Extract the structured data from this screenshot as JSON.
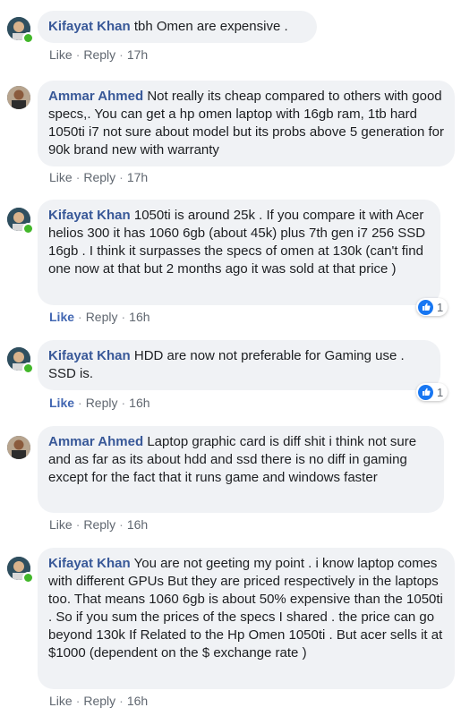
{
  "comments": [
    {
      "author": "Kifayat Khan",
      "text": "tbh Omen are expensive .",
      "like": "Like",
      "reply": "Reply",
      "time": "17h"
    },
    {
      "author": "Ammar Ahmed",
      "text": "Not really its cheap compared to others with good specs,. You can get a hp omen laptop with 16gb ram, 1tb hard 1050ti i7 not sure about model but its probs above 5 generation for 90k brand new with warranty",
      "like": "Like",
      "reply": "Reply",
      "time": "17h"
    },
    {
      "author": "Kifayat Khan",
      "text": "1050ti is around 25k . If you compare it with Acer helios 300 it has 1060 6gb (about 45k) plus 7th gen i7 256 SSD 16gb . I think it surpasses the specs of omen at 130k (can't find one now at that but 2 months ago it was sold at that price )",
      "like": "Like",
      "reply": "Reply",
      "time": "16h",
      "reactions": "1"
    },
    {
      "author": "Kifayat Khan",
      "text": "HDD are now not preferable for Gaming use . SSD is.",
      "like": "Like",
      "reply": "Reply",
      "time": "16h",
      "reactions": "1"
    },
    {
      "author": "Ammar Ahmed",
      "text": "Laptop graphic card is diff shit i think not sure and as far as its about hdd and ssd there is no diff in gaming except for the fact that it runs game and windows faster",
      "like": "Like",
      "reply": "Reply",
      "time": "16h"
    },
    {
      "author": "Kifayat Khan",
      "text": "You are not geeting my point . i know laptop comes with different GPUs But they are priced respectively in the laptops too. That means 1060 6gb is about 50% expensive than the 1050ti . So if you sum the prices of the specs I shared . the price can go beyond 130k If Related to the Hp Omen 1050ti . But acer sells it at $1000 (dependent on the $ exchange rate )",
      "like": "Like",
      "reply": "Reply",
      "time": "16h"
    }
  ],
  "colors": {
    "author": "#385898",
    "bubble": "#f0f2f5",
    "like_active": "#4267b2",
    "online": "#42b72a",
    "reaction": "#1877f2"
  }
}
